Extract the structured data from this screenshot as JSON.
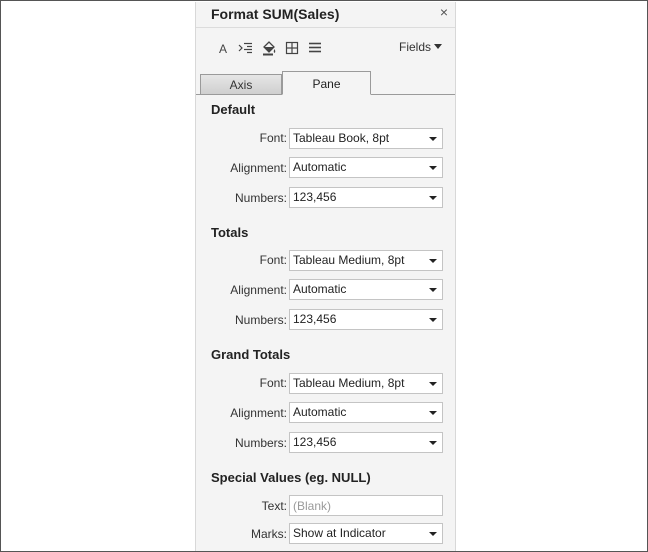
{
  "panel": {
    "title": "Format SUM(Sales)",
    "close_glyph": "×"
  },
  "toolbar": {
    "icons": [
      "font-icon",
      "alignment-icon",
      "shading-icon",
      "borders-icon",
      "lines-icon"
    ],
    "fields_label": "Fields"
  },
  "tabs": {
    "axis_label": "Axis",
    "pane_label": "Pane",
    "active": "Pane"
  },
  "sections": {
    "default": {
      "heading": "Default",
      "font_label": "Font:",
      "font_value": "Tableau Book, 8pt",
      "alignment_label": "Alignment:",
      "alignment_value": "Automatic",
      "numbers_label": "Numbers:",
      "numbers_value": "123,456"
    },
    "totals": {
      "heading": "Totals",
      "font_label": "Font:",
      "font_value": "Tableau Medium, 8pt",
      "alignment_label": "Alignment:",
      "alignment_value": "Automatic",
      "numbers_label": "Numbers:",
      "numbers_value": "123,456"
    },
    "grand_totals": {
      "heading": "Grand Totals",
      "font_label": "Font:",
      "font_value": "Tableau Medium, 8pt",
      "alignment_label": "Alignment:",
      "alignment_value": "Automatic",
      "numbers_label": "Numbers:",
      "numbers_value": "123,456"
    },
    "special_values": {
      "heading": "Special Values (eg. NULL)",
      "text_label": "Text:",
      "text_value": "",
      "text_placeholder": "(Blank)",
      "marks_label": "Marks:",
      "marks_value": "Show at Indicator"
    }
  },
  "colors": {
    "panel_bg": "#f4f4f4",
    "border": "#c4c4c4",
    "tab_border": "#9a9a9a"
  }
}
